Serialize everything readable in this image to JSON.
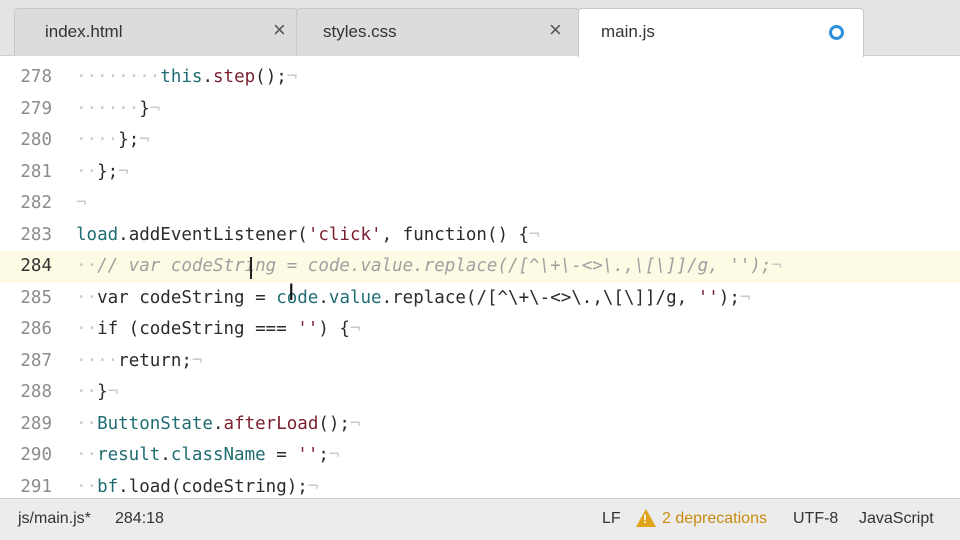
{
  "tabs": [
    {
      "title": "index.html",
      "close": "×"
    },
    {
      "title": "styles.css",
      "close": "×"
    },
    {
      "title": "main.js",
      "modified": true
    }
  ],
  "editor": {
    "lines": [
      {
        "num": "278",
        "indent": "········",
        "html": "<span class=\"prop\">this</span>.<span class=\"fn\">step</span>();"
      },
      {
        "num": "279",
        "indent": "······",
        "html": "}"
      },
      {
        "num": "280",
        "indent": "····",
        "html": "};"
      },
      {
        "num": "281",
        "indent": "··",
        "html": "};"
      },
      {
        "num": "282",
        "indent": "",
        "html": ""
      },
      {
        "num": "283",
        "indent": "",
        "html": "<span class=\"prop\">load</span>.<span class=\"kw\">addEventListener</span>(<span class=\"str\">'click'</span>, function() {"
      },
      {
        "num": "284",
        "indent": "··",
        "html": "<span class=\"cm\">// var codeString = code.value.replace(/[^\\+\\-<>\\.,\\[\\]]/g, '');</span>",
        "current": true
      },
      {
        "num": "285",
        "indent": "··",
        "html": "var codeString = <span class=\"prop\">code</span>.<span class=\"prop\">value</span>.<span class=\"kw\">replace</span>(/[^\\+\\-<>\\.,\\[\\]]/g, <span class=\"str\">''</span>);"
      },
      {
        "num": "286",
        "indent": "··",
        "html": "if (codeString === <span class=\"str\">''</span>) {"
      },
      {
        "num": "287",
        "indent": "····",
        "html": "return;"
      },
      {
        "num": "288",
        "indent": "··",
        "html": "}"
      },
      {
        "num": "289",
        "indent": "··",
        "html": "<span class=\"prop\">ButtonState</span>.<span class=\"fn\">afterLoad</span>();"
      },
      {
        "num": "290",
        "indent": "··",
        "html": "<span class=\"prop\">result</span>.<span class=\"prop\">className</span> = <span class=\"str\">''</span>;"
      },
      {
        "num": "291",
        "indent": "··",
        "html": "<span class=\"prop\">bf</span>.<span class=\"kw\">load</span>(codeString);"
      }
    ]
  },
  "status": {
    "file": "js/main.js*",
    "position": "284:18",
    "line_ending": "LF",
    "warnings": "2 deprecations",
    "encoding": "UTF-8",
    "language": "JavaScript"
  },
  "colors": {
    "accent": "#2d8fd9",
    "warning": "#e0a31a",
    "current_line": "#fdfbe3"
  }
}
